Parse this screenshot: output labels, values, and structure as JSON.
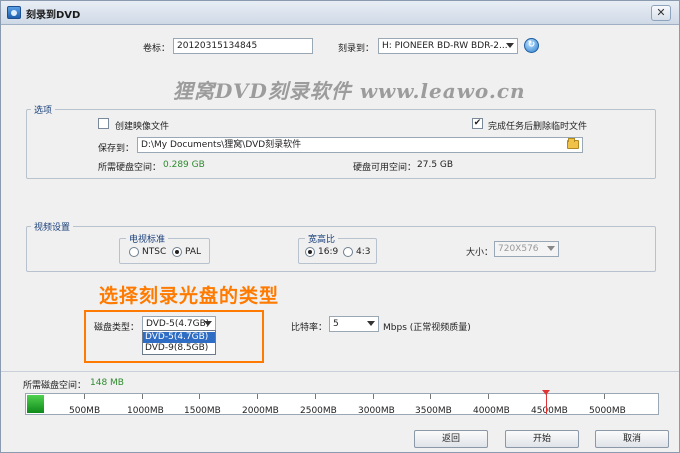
{
  "window": {
    "title": "刻录到DVD",
    "close_glyph": "✕"
  },
  "header": {
    "volume_label": "卷标：",
    "volume_value": "20120315134845",
    "burn_to_label": "刻录到：",
    "burn_to_value": "H: PIONEER  BD-RW   BDR-2..."
  },
  "watermark": "狸窝DVD刻录软件 www.leawo.cn",
  "options": {
    "title": "选项",
    "create_image_label": "创建映像文件",
    "create_image_checked": false,
    "delete_temp_label": "完成任务后删除临时文件",
    "delete_temp_checked": true,
    "save_to_label": "保存到：",
    "save_to_value": "D:\\My Documents\\狸窝\\DVD刻录软件",
    "required_space_label": "所需硬盘空间：",
    "required_space_value": "0.289 GB",
    "available_space_label": "硬盘可用空间：",
    "available_space_value": "27.5 GB"
  },
  "video": {
    "title": "视频设置",
    "standard_title": "电视标准",
    "ntsc_label": "NTSC",
    "pal_label": "PAL",
    "standard_selected": "PAL",
    "aspect_title": "宽高比",
    "aspect_169_label": "16:9",
    "aspect_43_label": "4:3",
    "aspect_selected": "16:9",
    "size_label": "大小：",
    "size_value": "720X576"
  },
  "annotation": "选择刻录光盘的类型",
  "disc": {
    "type_label": "磁盘类型：",
    "type_value": "DVD-5(4.7GB)",
    "options": [
      "DVD-5(4.7GB)",
      "DVD-9(8.5GB)"
    ],
    "selected_index": 0,
    "bitrate_label": "比特率：",
    "bitrate_value": "5",
    "bitrate_unit": "Mbps (正常视频质量)"
  },
  "capacity": {
    "label": "所需磁盘空间：",
    "value": "148 MB",
    "used_mb": 148,
    "max_mb": 5500,
    "limit_mb": 4500,
    "ticks": [
      "500MB",
      "1000MB",
      "1500MB",
      "2000MB",
      "2500MB",
      "3000MB",
      "3500MB",
      "4000MB",
      "4500MB",
      "5000MB"
    ]
  },
  "buttons": {
    "back": "返回",
    "start": "开始",
    "cancel": "取消"
  },
  "colors": {
    "accent_orange": "#ff7a00",
    "green": "#2e8b2e",
    "selection_blue": "#2f6dc4"
  },
  "icons": {
    "app": "dvd-burn-icon",
    "refresh": "refresh-icon",
    "folder": "folder-icon"
  }
}
